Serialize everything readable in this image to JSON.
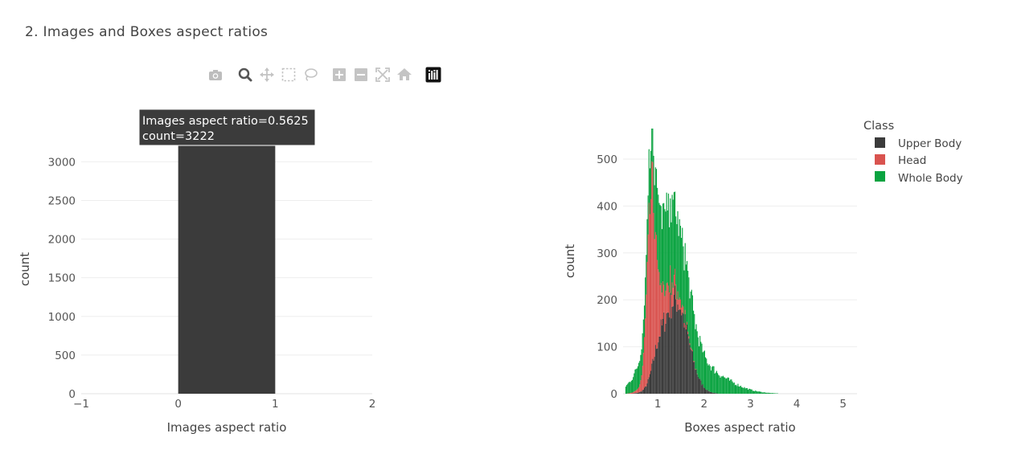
{
  "page": {
    "title": "2. Images and Boxes aspect ratios"
  },
  "modebar": {
    "buttons": [
      {
        "name": "camera-icon"
      },
      {
        "name": "zoom-icon",
        "active": true
      },
      {
        "name": "pan-icon"
      },
      {
        "name": "box-select-icon"
      },
      {
        "name": "lasso-select-icon"
      },
      {
        "name": "zoom-in-icon"
      },
      {
        "name": "zoom-out-icon"
      },
      {
        "name": "autoscale-icon"
      },
      {
        "name": "reset-axes-icon"
      },
      {
        "name": "plotly-logo-icon"
      }
    ]
  },
  "tooltip": {
    "line1": "Images aspect ratio=0.5625",
    "line2": "count=3222"
  },
  "chart_data": [
    {
      "type": "bar",
      "xlabel": "Images aspect ratio",
      "ylabel": "count",
      "xlim": [
        -1,
        2
      ],
      "ylim": [
        0,
        3222
      ],
      "x_ticks": [
        -1,
        0,
        1,
        2
      ],
      "x_tick_labels": [
        "−1",
        "0",
        "1",
        "2"
      ],
      "y_ticks": [
        0,
        500,
        1000,
        1500,
        2000,
        2500,
        3000
      ],
      "y_tick_labels": [
        "0",
        "500",
        "1000",
        "1500",
        "2000",
        "2500",
        "3000"
      ],
      "bins": [
        {
          "x0": 0,
          "x1": 1,
          "value": 3222
        }
      ],
      "color": "#3b3b3b",
      "grid": true
    },
    {
      "type": "bar",
      "barmode": "stack",
      "xlabel": "Boxes aspect ratio",
      "ylabel": "count",
      "xlim": [
        0.25,
        5.3
      ],
      "ylim": [
        0,
        565
      ],
      "x_ticks": [
        1,
        2,
        3,
        4,
        5
      ],
      "x_tick_labels": [
        "1",
        "2",
        "3",
        "4",
        "5"
      ],
      "y_ticks": [
        0,
        100,
        200,
        300,
        400,
        500
      ],
      "y_tick_labels": [
        "0",
        "100",
        "200",
        "300",
        "400",
        "500"
      ],
      "legend": {
        "title": "Class",
        "placement": "top-right"
      },
      "bin_width": 0.02,
      "series": [
        {
          "name": "Upper Body",
          "color": "#3b3b3b",
          "peaks": [
            {
              "center": 1.38,
              "sigma": 0.27,
              "height": 200
            },
            {
              "center": 1.0,
              "sigma": 0.12,
              "height": 40
            }
          ]
        },
        {
          "name": "Head",
          "color": "#d9534f",
          "peaks": [
            {
              "center": 0.86,
              "sigma": 0.09,
              "height": 330
            },
            {
              "center": 1.1,
              "sigma": 0.25,
              "height": 65
            }
          ]
        },
        {
          "name": "Whole Body",
          "color": "#0aa340",
          "peaks": [
            {
              "center": 1.2,
              "sigma": 0.42,
              "height": 150
            },
            {
              "center": 2.0,
              "sigma": 0.55,
              "height": 45
            }
          ]
        }
      ],
      "grid": true
    }
  ]
}
